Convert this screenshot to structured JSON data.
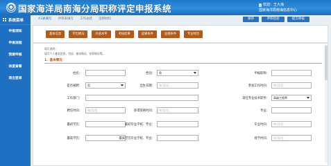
{
  "app_title": "国家海洋局南海分局职称评定申报系统",
  "user": {
    "welcome": "欢迎：王大海",
    "org": "国家海洋局南海信息中心"
  },
  "tabs": [
    "A3表填写",
    "评审表填写",
    "工作总结",
    "证明材料"
  ],
  "top_buttons": [
    "保存",
    "评审检验",
    "提交审核"
  ],
  "sidebar": {
    "title": "系统菜单",
    "items": [
      "申报须知",
      "申报流程",
      "我要申报",
      "进度查看",
      "退出登录"
    ]
  },
  "toolbar_buttons": [
    "基本信息",
    "学历情况",
    "外语水平",
    "考核结果",
    "成果条件",
    "业绩条件",
    "专业经历"
  ],
  "notes": {
    "line1": "填写说明：",
    "line2": "填写个人基本信息，包括：基本情况、任职情况等。"
  },
  "section_title": "1、基本情况",
  "form": {
    "name_label": "姓名：",
    "gender_label": "性别：",
    "gender_value": "男",
    "title_level_label": "申报职称：",
    "cadre_label": "是否被聘：",
    "cadre_value": "否",
    "birth_label": "出生日期：",
    "work_start_label": "参加工作时间：",
    "date_placeholder": "年/月/日",
    "work_unit_label": "工作部门：",
    "current_title_label": "现任专业技术职务：",
    "current_title_value": "高级工程师",
    "hire_time_label": "聘任时间：",
    "obtain_time_label": "获得资格时间：",
    "major_label": "专业：",
    "first_degree_label": "最初学历：",
    "first_grad_label": "最初毕业学校、专业：",
    "grad_time_label": "毕业时间：",
    "highest_degree_label": "最高学历：",
    "highest_grad_label": "最高学历毕业学校、专业：",
    "award_time_label": "授予时间："
  }
}
